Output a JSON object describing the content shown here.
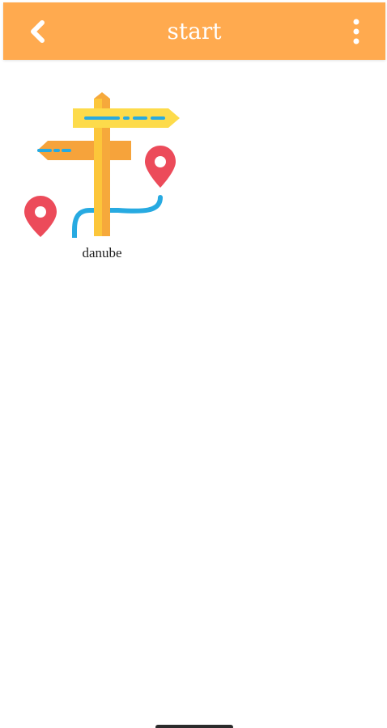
{
  "colors": {
    "accent": "#ffaa4f",
    "title_text": "#ffffff",
    "label_text": "#222222"
  },
  "appbar": {
    "title": "start",
    "back_icon": "chevron-left-icon",
    "menu_icon": "more-vert-icon"
  },
  "items": [
    {
      "label": "danube",
      "icon": "signpost-map-icon"
    }
  ]
}
